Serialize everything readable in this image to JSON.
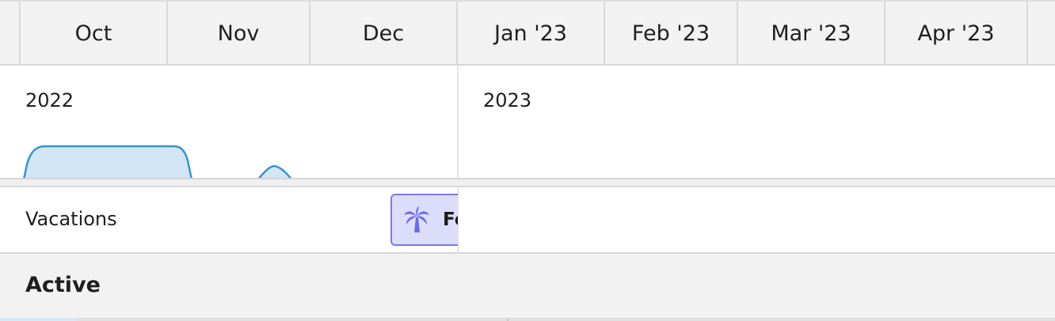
{
  "timeline": {
    "months": [
      {
        "label": "Oct"
      },
      {
        "label": "Nov"
      },
      {
        "label": "Dec"
      },
      {
        "label": "Jan '23"
      },
      {
        "label": "Feb '23"
      },
      {
        "label": "Mar '23"
      },
      {
        "label": "Apr '23"
      }
    ],
    "years": [
      {
        "label": "2022"
      },
      {
        "label": "2023"
      }
    ]
  },
  "rows": {
    "vacations": {
      "label": "Vacations",
      "event": {
        "title": "Fe",
        "icon": "palm-tree-icon",
        "fill": "#dcdcfb",
        "border": "#7c78ec",
        "icon_color": "#6f6be6"
      }
    },
    "active": {
      "label": "Active"
    }
  },
  "colors": {
    "density_fill": "#d2e6f6",
    "density_stroke": "#3a92d2"
  }
}
